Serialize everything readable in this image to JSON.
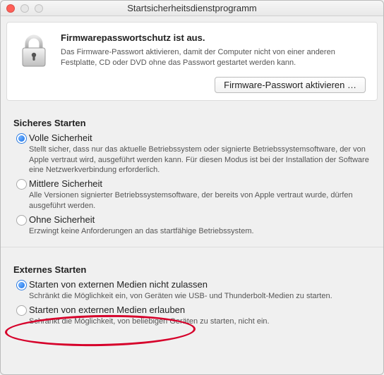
{
  "window": {
    "title": "Startsicherheitsdienstprogramm"
  },
  "firmware": {
    "heading": "Firmwarepasswortschutz ist aus.",
    "description": "Das Firmware-Passwort aktivieren, damit der Computer nicht von einer anderen Festplatte, CD oder DVD ohne das Passwort gestartet werden kann.",
    "button": "Firmware-Passwort aktivieren …"
  },
  "secure_boot": {
    "heading": "Sicheres Starten",
    "options": [
      {
        "label": "Volle Sicherheit",
        "desc": "Stellt sicher, dass nur das aktuelle Betriebssystem oder signierte Betriebssystemsoftware, der von Apple vertraut wird, ausgeführt werden kann. Für diesen Modus ist bei der Installation der Software eine Netzwerkverbindung erforderlich.",
        "selected": true
      },
      {
        "label": "Mittlere Sicherheit",
        "desc": "Alle Versionen signierter Betriebssystemsoftware, der bereits von Apple vertraut wurde, dürfen ausgeführt werden.",
        "selected": false
      },
      {
        "label": "Ohne Sicherheit",
        "desc": "Erzwingt keine Anforderungen an das startfähige Betriebssystem.",
        "selected": false
      }
    ]
  },
  "external_boot": {
    "heading": "Externes Starten",
    "options": [
      {
        "label": "Starten von externen Medien nicht zulassen",
        "desc": "Schränkt die Möglichkeit ein, von Geräten wie USB- und Thunderbolt-Medien zu starten.",
        "selected": true
      },
      {
        "label": "Starten von externen Medien erlauben",
        "desc": "Schränkt die Möglichkeit, von beliebigen Geräten zu starten, nicht ein.",
        "selected": false
      }
    ]
  }
}
